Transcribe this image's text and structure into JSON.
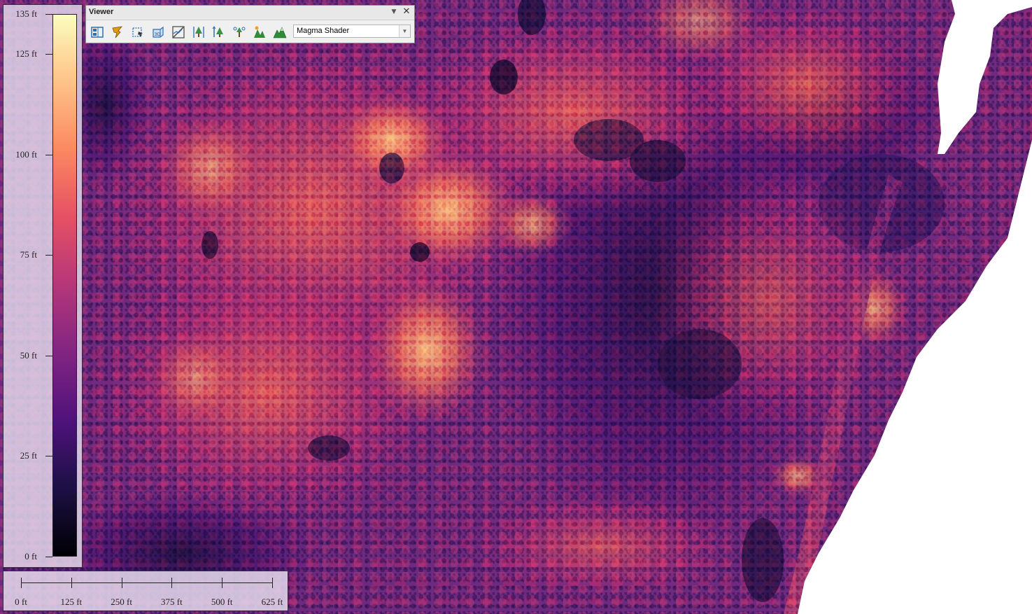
{
  "viewer": {
    "title": "Viewer",
    "pin_glyph": "▼",
    "close_glyph": "✕",
    "tools": [
      {
        "name": "layout-icon",
        "color": "#2f6db3"
      },
      {
        "name": "pointer-icon",
        "color": "#c87800"
      },
      {
        "name": "select-area-icon",
        "color": "#2f6db3"
      },
      {
        "name": "3d-view-icon",
        "color": "#2f6db3"
      },
      {
        "name": "profile-icon",
        "color": "#444444"
      },
      {
        "name": "tree-measure-icon",
        "color": "#2f6db3"
      },
      {
        "name": "tree-height-icon",
        "color": "#2f6db3"
      },
      {
        "name": "tree-detect-icon",
        "color": "#2f6db3"
      },
      {
        "name": "canopy-icon",
        "color": "#2e8b3a"
      },
      {
        "name": "terrain-icon",
        "color": "#2e8b3a"
      }
    ],
    "shader_select": {
      "value": "Magma Shader",
      "arrow_glyph": "▼"
    }
  },
  "legend": {
    "unit": "ft",
    "min": 0,
    "max": 135,
    "ticks": [
      {
        "value": 135,
        "label": "135 ft"
      },
      {
        "value": 125,
        "label": "125 ft"
      },
      {
        "value": 100,
        "label": "100 ft"
      },
      {
        "value": 75,
        "label": "75 ft"
      },
      {
        "value": 50,
        "label": "50 ft"
      },
      {
        "value": 25,
        "label": "25 ft"
      },
      {
        "value": 0,
        "label": "0 ft"
      }
    ],
    "colormap": [
      "#000004",
      "#1c1044",
      "#4f127b",
      "#812581",
      "#b5367a",
      "#e55064",
      "#fb8861",
      "#fec287",
      "#fcfdbf"
    ]
  },
  "scalebar": {
    "max": 625,
    "ticks": [
      {
        "value": 0,
        "label": "0 ft"
      },
      {
        "value": 125,
        "label": "125 ft"
      },
      {
        "value": 250,
        "label": "250 ft"
      },
      {
        "value": 375,
        "label": "375 ft"
      },
      {
        "value": 500,
        "label": "500 ft"
      },
      {
        "value": 625,
        "label": "625 ft"
      }
    ]
  },
  "map": {
    "no_data_color": "#ffffff"
  }
}
